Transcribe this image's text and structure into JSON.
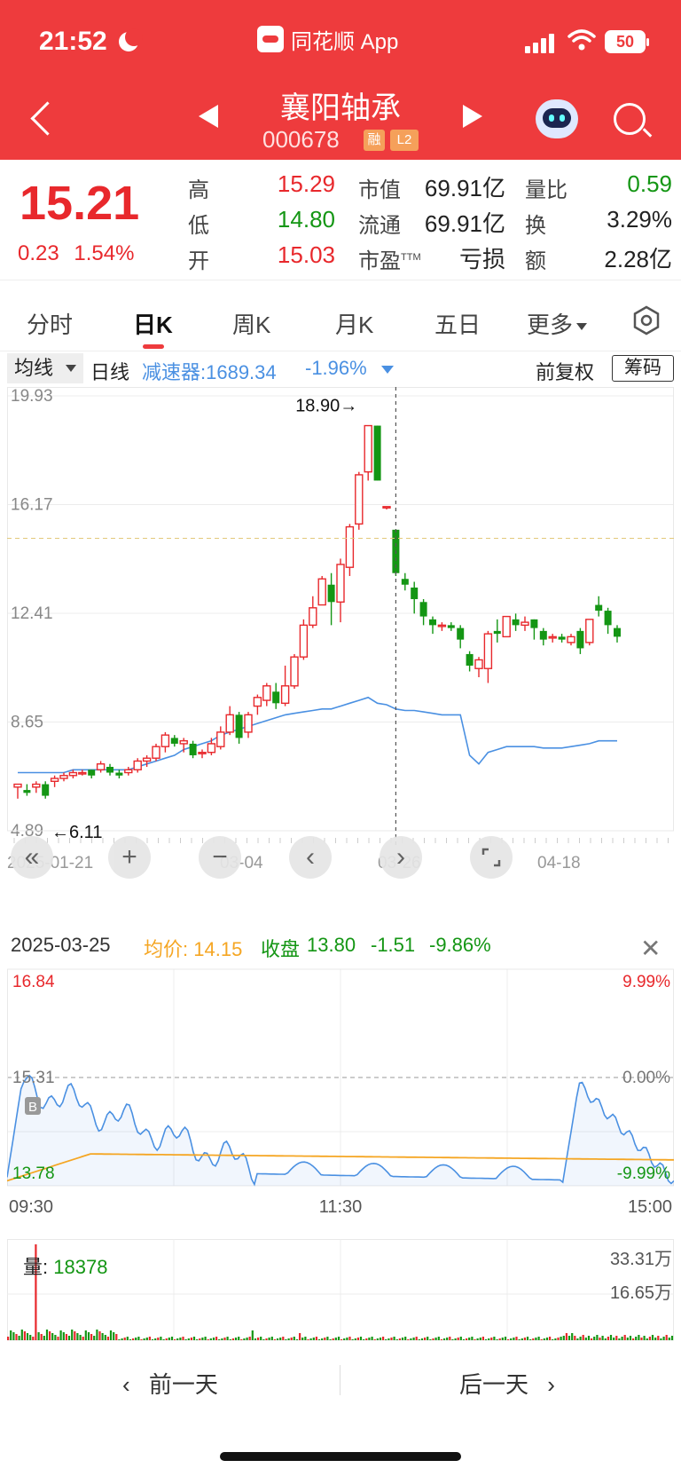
{
  "status": {
    "time": "21:52",
    "app": "同花顺 App",
    "battery": "50"
  },
  "header": {
    "name": "襄阳轴承",
    "code": "000678",
    "tag_margin": "融",
    "tag_level": "L2"
  },
  "quote": {
    "price": "15.21",
    "change": "0.23",
    "change_pct": "1.54%",
    "high_label": "高",
    "high": "15.29",
    "low_label": "低",
    "low": "14.80",
    "open_label": "开",
    "open": "15.03",
    "mcap_label": "市值",
    "mcap": "69.91亿",
    "float_label": "流通",
    "float": "69.91亿",
    "pe_label": "市盈",
    "pe_sup": "TTM",
    "pe": "亏损",
    "vr_label": "量比",
    "vr": "0.59",
    "turnover_label": "换",
    "turnover": "3.29%",
    "amount_label": "额",
    "amount": "2.28亿"
  },
  "tabs": [
    "分时",
    "日K",
    "周K",
    "月K",
    "五日",
    "更多"
  ],
  "toolbar": {
    "ma": "均线",
    "line": "日线",
    "indicator": "减速器:1689.34",
    "indicator_chg": "-1.96%",
    "adjust": "前复权",
    "chips": "筹码"
  },
  "kchart": {
    "y_labels": [
      "19.93",
      "16.17",
      "12.41",
      "8.65",
      "4.89"
    ],
    "x_labels": [
      "2025-01-21",
      "03-04",
      "03-26",
      "04-18"
    ],
    "max_label": "18.90→",
    "min_label": "←6.11",
    "ylim": [
      4.89,
      19.93
    ]
  },
  "detail": {
    "date": "2025-03-25",
    "avg_label": "均价:",
    "avg": "14.15",
    "close_label": "收盘",
    "close": "13.80",
    "chg": "-1.51",
    "chg_pct": "-9.86%"
  },
  "intraday": {
    "y_left": [
      "16.84",
      "15.31",
      "13.78"
    ],
    "y_right": [
      "9.99%",
      "0.00%",
      "-9.99%"
    ],
    "x_labels": [
      "09:30",
      "11:30",
      "15:00"
    ],
    "b_marker": "B"
  },
  "volume": {
    "label": "量:",
    "value": "18378",
    "y_labels": [
      "33.31万",
      "16.65万"
    ]
  },
  "daynav": {
    "prev": "前一天",
    "next": "后一天"
  },
  "colors": {
    "up": "#e8282c",
    "down": "#149614",
    "header": "#ee3b3d",
    "ma": "#4a90e2",
    "avg": "#f5a623"
  },
  "chart_data": {
    "type": "candlestick",
    "ylim": [
      4.89,
      19.93
    ],
    "candles": [
      [
        6.4,
        6.5,
        6.0,
        6.5
      ],
      [
        6.3,
        6.2,
        6.1,
        6.5
      ],
      [
        6.4,
        6.5,
        6.2,
        6.6
      ],
      [
        6.5,
        6.1,
        6.0,
        6.6
      ],
      [
        6.6,
        6.7,
        6.4,
        6.8
      ],
      [
        6.7,
        6.8,
        6.6,
        6.9
      ],
      [
        6.8,
        6.9,
        6.7,
        7.0
      ],
      [
        6.9,
        6.9,
        6.8,
        7.0
      ],
      [
        7.0,
        6.8,
        6.7,
        7.0
      ],
      [
        7.0,
        7.2,
        6.9,
        7.3
      ],
      [
        7.1,
        6.9,
        6.8,
        7.2
      ],
      [
        6.9,
        6.8,
        6.7,
        7.0
      ],
      [
        6.9,
        7.0,
        6.8,
        7.1
      ],
      [
        7.0,
        7.3,
        6.9,
        7.4
      ],
      [
        7.3,
        7.4,
        7.1,
        7.5
      ],
      [
        7.4,
        7.8,
        7.3,
        7.9
      ],
      [
        7.8,
        8.2,
        7.6,
        8.3
      ],
      [
        8.1,
        7.9,
        7.8,
        8.2
      ],
      [
        7.9,
        8.0,
        7.6,
        8.1
      ],
      [
        7.9,
        7.5,
        7.4,
        8.0
      ],
      [
        7.6,
        7.6,
        7.4,
        7.7
      ],
      [
        7.6,
        7.9,
        7.5,
        8.1
      ],
      [
        7.8,
        8.3,
        7.7,
        8.5
      ],
      [
        8.3,
        8.9,
        8.2,
        9.2
      ],
      [
        8.9,
        8.1,
        7.9,
        9.0
      ],
      [
        8.3,
        8.9,
        8.1,
        9.0
      ],
      [
        9.2,
        9.5,
        8.9,
        9.6
      ],
      [
        9.4,
        9.9,
        9.2,
        10.0
      ],
      [
        9.7,
        9.3,
        9.1,
        10.0
      ],
      [
        9.3,
        9.9,
        9.2,
        10.6
      ],
      [
        9.9,
        10.9,
        9.8,
        11.0
      ],
      [
        10.9,
        12.0,
        10.8,
        12.2
      ],
      [
        12.0,
        12.6,
        11.9,
        13.0
      ],
      [
        12.7,
        13.6,
        12.7,
        13.7
      ],
      [
        13.4,
        12.8,
        12.0,
        13.8
      ],
      [
        12.8,
        14.1,
        12.1,
        14.3
      ],
      [
        14.0,
        15.4,
        13.7,
        15.5
      ],
      [
        15.5,
        17.2,
        15.3,
        17.3
      ],
      [
        17.3,
        18.9,
        17.0,
        18.9
      ],
      [
        18.9,
        17.0,
        17.0,
        18.9
      ],
      [
        16.1,
        16.1,
        16.0,
        16.1
      ],
      [
        15.3,
        13.8,
        13.7,
        15.3
      ],
      [
        13.6,
        13.4,
        13.2,
        13.8
      ],
      [
        13.3,
        12.9,
        12.4,
        13.5
      ],
      [
        12.8,
        12.3,
        12.0,
        12.9
      ],
      [
        12.2,
        12.0,
        11.7,
        12.3
      ],
      [
        12.0,
        12.0,
        11.8,
        12.1
      ],
      [
        12.0,
        11.9,
        11.8,
        12.1
      ],
      [
        11.9,
        11.5,
        11.2,
        12.0
      ],
      [
        11.0,
        10.6,
        10.4,
        11.1
      ],
      [
        10.5,
        10.8,
        10.2,
        10.9
      ],
      [
        10.5,
        11.7,
        10.0,
        11.8
      ],
      [
        11.8,
        11.7,
        11.4,
        12.2
      ],
      [
        11.6,
        12.3,
        11.6,
        12.3
      ],
      [
        12.2,
        12.0,
        11.8,
        12.4
      ],
      [
        12.0,
        12.1,
        11.8,
        12.3
      ],
      [
        12.2,
        11.9,
        11.5,
        12.2
      ],
      [
        11.8,
        11.5,
        11.3,
        11.9
      ],
      [
        11.6,
        11.6,
        11.4,
        11.7
      ],
      [
        11.6,
        11.5,
        11.4,
        11.7
      ],
      [
        11.4,
        11.6,
        11.3,
        11.7
      ],
      [
        11.8,
        11.2,
        11.0,
        11.9
      ],
      [
        11.4,
        12.2,
        11.3,
        12.2
      ],
      [
        12.7,
        12.5,
        12.3,
        13.0
      ],
      [
        12.5,
        12.0,
        11.7,
        12.6
      ],
      [
        11.9,
        11.6,
        11.4,
        12.0
      ]
    ],
    "ma": [
      6.9,
      6.9,
      6.9,
      6.9,
      6.9,
      6.9,
      7.0,
      7.0,
      7.0,
      7.0,
      7.0,
      7.0,
      7.0,
      7.1,
      7.2,
      7.3,
      7.4,
      7.5,
      7.7,
      7.8,
      7.9,
      8.0,
      8.2,
      8.3,
      8.4,
      8.5,
      8.6,
      8.7,
      8.8,
      8.9,
      8.95,
      9.0,
      9.05,
      9.1,
      9.1,
      9.2,
      9.3,
      9.4,
      9.5,
      9.3,
      9.25,
      9.1,
      9.05,
      9.05,
      9.0,
      8.95,
      8.9,
      8.9,
      8.9,
      7.5,
      7.2,
      7.6,
      7.7,
      7.8,
      7.8,
      7.8,
      7.8,
      7.75,
      7.75,
      7.75,
      7.8,
      7.85,
      7.9,
      8.0,
      8.0,
      8.0
    ]
  }
}
